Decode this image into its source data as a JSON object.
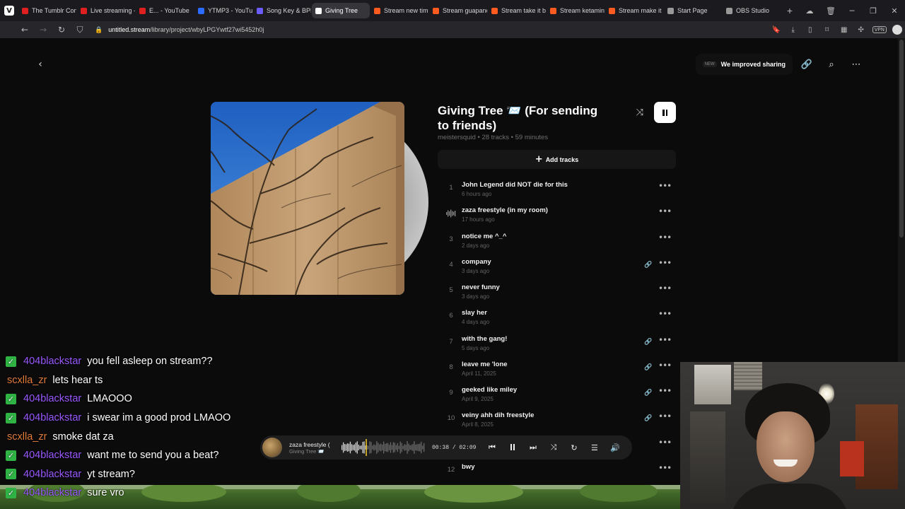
{
  "browser": {
    "tabs": [
      {
        "label": "The Tumblr Con",
        "fav_color": "#e02020"
      },
      {
        "label": "Live streaming -",
        "fav_color": "#e02020"
      },
      {
        "label": "E... - YouTube",
        "fav_color": "#e02020"
      },
      {
        "label": "YTMP3 - YouTub",
        "fav_color": "#2b6bff"
      },
      {
        "label": "Song Key & BPM",
        "fav_color": "#6b5cff"
      },
      {
        "label": "Giving Tree",
        "fav_color": "#ffffff"
      },
      {
        "label": "Stream new tim",
        "fav_color": "#ff5a1f"
      },
      {
        "label": "Stream guapane",
        "fav_color": "#ff5a1f"
      },
      {
        "label": "Stream take it b",
        "fav_color": "#ff5a1f"
      },
      {
        "label": "Stream ketamin",
        "fav_color": "#ff5a1f"
      },
      {
        "label": "Stream make it",
        "fav_color": "#ff5a1f"
      },
      {
        "label": "Start Page",
        "fav_color": "#999999"
      },
      {
        "label": "OBS Studio",
        "fav_color": "#999999"
      }
    ],
    "active_tab_index": 5,
    "url_domain": "untitled.stream",
    "url_path": "/library/project/wbyLPGYwtf27wi5452h0j"
  },
  "header": {
    "new_badge": "NEW",
    "share_label": "We improved sharing"
  },
  "project": {
    "title": "Giving Tree 📨 (For sending to friends)",
    "meta": "meistersquid • 28 tracks • 59 minutes",
    "add_tracks_label": "Add tracks"
  },
  "tracks": [
    {
      "num": "1",
      "name": "John Legend did NOT die for this",
      "time": "6 hours ago",
      "has_link": false,
      "playing": false
    },
    {
      "num": "2",
      "name": "zaza freestyle (in my room)",
      "time": "17 hours ago",
      "has_link": false,
      "playing": true
    },
    {
      "num": "3",
      "name": "notice me ^_^",
      "time": "2 days ago",
      "has_link": false,
      "playing": false
    },
    {
      "num": "4",
      "name": "company",
      "time": "3 days ago",
      "has_link": true,
      "playing": false
    },
    {
      "num": "5",
      "name": "never funny",
      "time": "3 days ago",
      "has_link": false,
      "playing": false
    },
    {
      "num": "6",
      "name": "slay her",
      "time": "4 days ago",
      "has_link": false,
      "playing": false
    },
    {
      "num": "7",
      "name": "with the gang!",
      "time": "5 days ago",
      "has_link": true,
      "playing": false
    },
    {
      "num": "8",
      "name": "leave me 'lone",
      "time": "April 11, 2025",
      "has_link": true,
      "playing": false
    },
    {
      "num": "9",
      "name": "geeked like miley",
      "time": "April 9, 2025",
      "has_link": true,
      "playing": false
    },
    {
      "num": "10",
      "name": "veiny ahh dih freestyle",
      "time": "April 8, 2025",
      "has_link": true,
      "playing": false
    },
    {
      "num": "11",
      "name": "",
      "time": "",
      "has_link": false,
      "playing": false
    },
    {
      "num": "12",
      "name": "bwy",
      "time": "",
      "has_link": false,
      "playing": false
    }
  ],
  "player": {
    "title": "zaza freestyle (",
    "subtitle": "Giving Tree 📨",
    "current_time": "00:38",
    "total_time": "02:09",
    "progress": 0.29
  },
  "chat": [
    {
      "user": "404blackstar",
      "color": "purple",
      "badge": true,
      "msg": "you fell asleep on stream??"
    },
    {
      "user": "scxlla_zr",
      "color": "orange",
      "badge": false,
      "msg": "lets hear ts"
    },
    {
      "user": "404blackstar",
      "color": "purple",
      "badge": true,
      "msg": "LMAOOO"
    },
    {
      "user": "404blackstar",
      "color": "purple",
      "badge": true,
      "msg": "i swear im a good prod LMAOO"
    },
    {
      "user": "scxlla_zr",
      "color": "orange",
      "badge": false,
      "msg": "smoke dat za"
    },
    {
      "user": "404blackstar",
      "color": "purple",
      "badge": true,
      "msg": "want me to send you a beat?"
    },
    {
      "user": "404blackstar",
      "color": "purple",
      "badge": true,
      "msg": "yt stream?"
    },
    {
      "user": "404blackstar",
      "color": "purple",
      "badge": true,
      "msg": "sure vro"
    }
  ],
  "colors": {
    "accent_purple": "#9a58ff",
    "accent_orange": "#e07b39",
    "badge_green": "#2fb344",
    "waveform_progress": "#e6c12a"
  }
}
